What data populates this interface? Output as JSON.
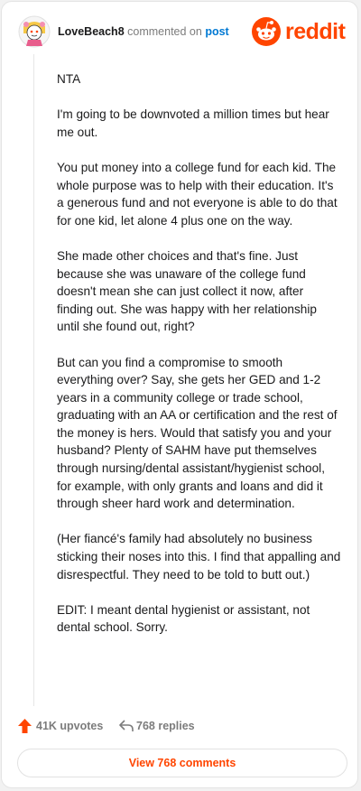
{
  "comment": {
    "username": "LoveBeach8",
    "commented_on": "commented on",
    "post_link": "post",
    "paragraphs": [
      "NTA",
      "I'm going to be downvoted a million times but hear me out.",
      "You put money into a college fund for each kid. The whole purpose was to help with their education. It's a generous fund and not everyone is able to do that for one kid, let alone 4 plus one on the way.",
      "She made other choices and that's fine. Just because she was unaware of the college fund doesn't mean she can just collect it now, after finding out. She was happy with her relationship until she found out, right?",
      "But can you find a compromise to smooth everything over? Say, she gets her GED and 1-2 years in a community college or trade school, graduating with an AA or certification and the rest of the money is hers. Would that satisfy you and your husband? Plenty of SAHM have put themselves through nursing/dental assistant/hygienist school, for example, with only grants and loans and did it through sheer hard work and determination.",
      "(Her fiancé's family had absolutely no business sticking their noses into this. I find that appalling and disrespectful. They need to be told to butt out.)",
      "EDIT: I meant dental hygienist or assistant, not dental school. Sorry."
    ]
  },
  "brand": {
    "logo_text": "reddit",
    "color": "#ff4500"
  },
  "actions": {
    "upvotes": "41K upvotes",
    "replies": "768 replies",
    "view_comments": "View 768 comments"
  },
  "icons": {
    "avatar": "snoo-avatar-icon",
    "logo": "reddit-logo-icon",
    "upvote": "upvote-arrow-icon",
    "reply": "reply-arrow-icon"
  }
}
